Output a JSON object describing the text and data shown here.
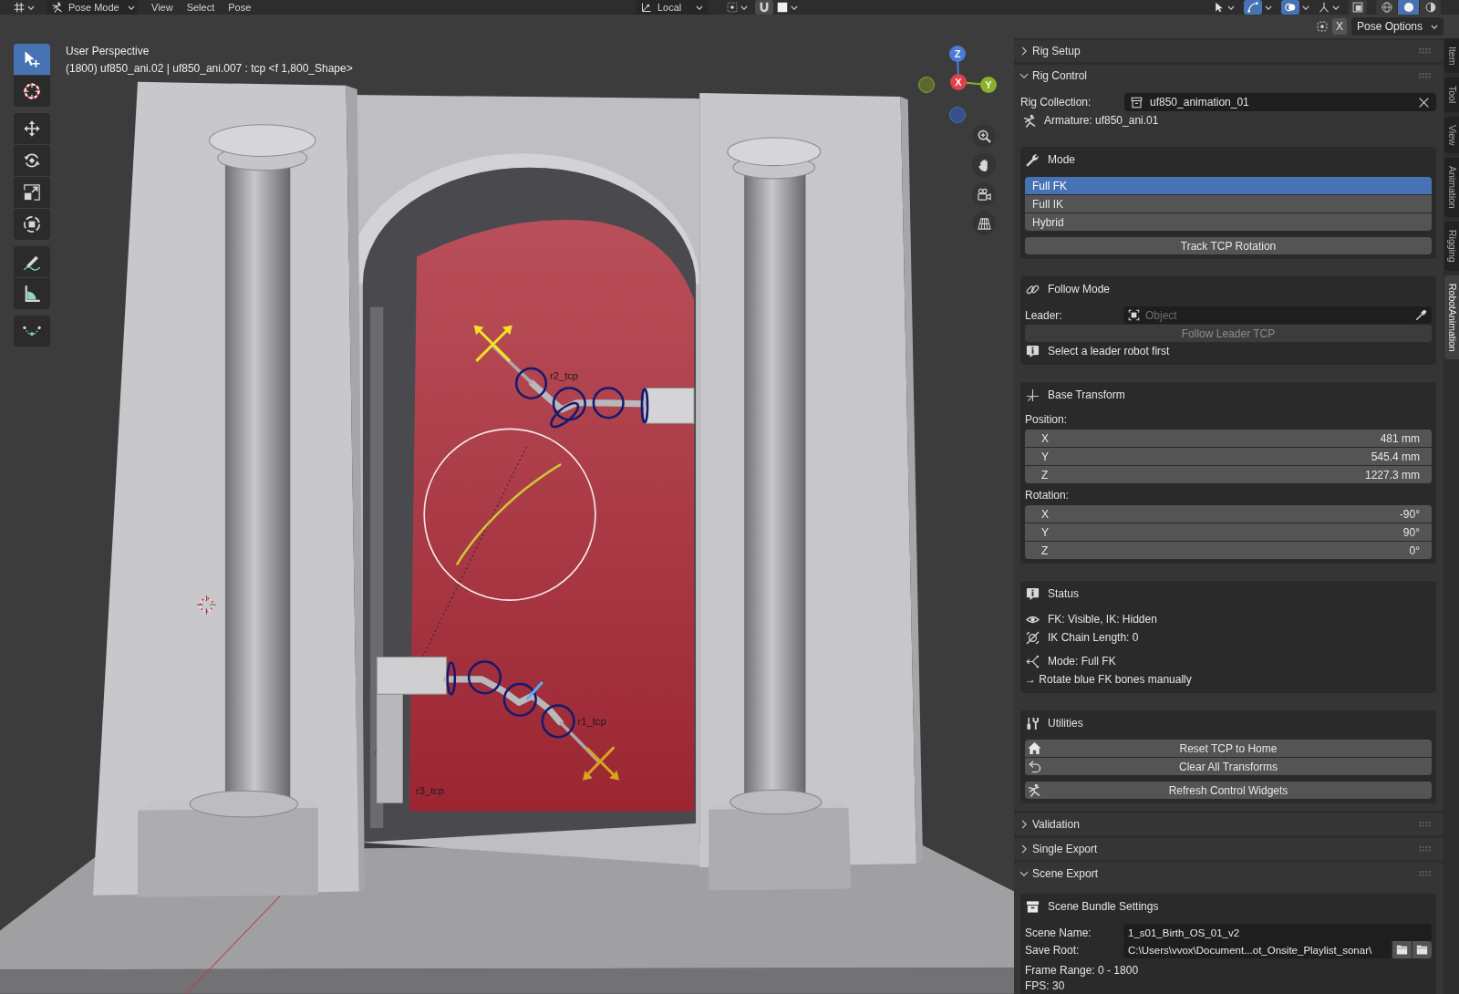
{
  "header": {
    "menus": [
      {
        "kind": "mode",
        "label": "Pose Mode"
      },
      {
        "kind": "menu",
        "label": "View"
      },
      {
        "kind": "menu",
        "label": "Select"
      },
      {
        "kind": "menu",
        "label": "Pose"
      }
    ],
    "orientation": "Local",
    "toggles": [
      {
        "kind": "gizmo",
        "on": true
      },
      {
        "kind": "overlay",
        "on": true
      },
      {
        "kind": "xray",
        "on": false
      }
    ],
    "shading": [
      {
        "kind": "wireframe",
        "selected": false
      },
      {
        "kind": "solid",
        "selected": true
      },
      {
        "kind": "material",
        "selected": false
      }
    ]
  },
  "viewport": {
    "title": "User Perspective",
    "info": "(1800) uf850_ani.02 | uf850_ani.007 : tcp <f 1,800_Shape>",
    "tool_groups": [
      [
        {
          "kind": "select",
          "selected": true
        },
        {
          "kind": "cursor",
          "selected": false
        }
      ],
      [
        {
          "kind": "move",
          "selected": false
        },
        {
          "kind": "rotate",
          "selected": false
        },
        {
          "kind": "scale",
          "selected": false
        },
        {
          "kind": "transform",
          "selected": false
        }
      ],
      [
        {
          "kind": "annotate",
          "selected": false
        },
        {
          "kind": "measure",
          "selected": false
        }
      ],
      [
        {
          "kind": "curve",
          "selected": false
        }
      ]
    ],
    "gizmo_axes": [
      {
        "label": "Z",
        "color": "#4b7bd8"
      },
      {
        "label": "X",
        "color": "#e0404e"
      },
      {
        "label": "Y",
        "color": "#8ab12c"
      }
    ],
    "nav_buttons": [
      {
        "kind": "zoom"
      },
      {
        "kind": "pan"
      },
      {
        "kind": "camera"
      },
      {
        "kind": "grid"
      }
    ],
    "bone_labels": [
      "r2_tcp",
      "r1_tcp",
      "r3_tcp"
    ]
  },
  "tool_header": {
    "toggle": "X",
    "options": "Pose Options"
  },
  "sidebar": {
    "tabs": [
      {
        "label": "Item",
        "selected": false
      },
      {
        "label": "Tool",
        "selected": false
      },
      {
        "label": "View",
        "selected": false
      },
      {
        "label": "Animation",
        "selected": false
      },
      {
        "label": "Rigging",
        "selected": false
      },
      {
        "label": "RobotAnimation",
        "selected": true
      }
    ],
    "panels": [
      {
        "title": "Rig Setup",
        "expanded": false
      },
      {
        "title": "Rig Control",
        "expanded": true,
        "collection": {
          "label": "Rig Collection:",
          "value": "uf850_animation_01"
        },
        "armature": "Armature: uf850_ani.01",
        "subpanels": [
          {
            "kind": "mode",
            "title": "Mode",
            "options": [
              {
                "label": "Full FK",
                "selected": true
              },
              {
                "label": "Full IK",
                "selected": false
              },
              {
                "label": "Hybrid",
                "selected": false
              }
            ],
            "buttons": [
              {
                "label": "Track TCP Rotation",
                "disabled": false
              }
            ]
          },
          {
            "kind": "follow",
            "title": "Follow Mode",
            "field": {
              "label": "Leader:",
              "placeholder": "Object"
            },
            "buttons": [
              {
                "label": "Follow Leader TCP",
                "disabled": true
              }
            ],
            "note": "Select a leader robot first"
          },
          {
            "kind": "transform",
            "title": "Base Transform",
            "groups": [
              {
                "label": "Position:",
                "rows": [
                  {
                    "axis": "X",
                    "value": "481 mm"
                  },
                  {
                    "axis": "Y",
                    "value": "545.4 mm"
                  },
                  {
                    "axis": "Z",
                    "value": "1227.3 mm"
                  }
                ]
              },
              {
                "label": "Rotation:",
                "rows": [
                  {
                    "axis": "X",
                    "value": "-90°"
                  },
                  {
                    "axis": "Y",
                    "value": "90°"
                  },
                  {
                    "axis": "Z",
                    "value": "0°"
                  }
                ]
              }
            ]
          },
          {
            "kind": "status",
            "title": "Status",
            "lines": [
              {
                "kind": "visibility",
                "text": "FK: Visible, IK: Hidden"
              },
              {
                "kind": "chain",
                "text": "IK Chain Length: 0"
              },
              {
                "kind": "mode",
                "text": "Mode: Full FK"
              },
              {
                "kind": "hint",
                "text": "→ Rotate blue FK bones manually"
              }
            ]
          },
          {
            "kind": "utilities",
            "title": "Utilities",
            "button_groups": [
              {
                "buttons": [
                  {
                    "kind": "home",
                    "label": "Reset TCP to Home"
                  },
                  {
                    "kind": "undo",
                    "label": "Clear All Transforms"
                  }
                ]
              },
              {
                "buttons": [
                  {
                    "kind": "armature",
                    "label": "Refresh Control Widgets"
                  }
                ]
              }
            ]
          }
        ]
      },
      {
        "title": "Validation",
        "expanded": false
      },
      {
        "title": "Single Export",
        "expanded": false
      },
      {
        "title": "Scene Export",
        "expanded": true,
        "subpanels": [
          {
            "kind": "bundle",
            "title": "Scene Bundle Settings",
            "fields": [
              {
                "kind": "text",
                "label": "Scene Name:",
                "value": "1_s01_Birth_OS_01_v2"
              },
              {
                "kind": "path",
                "label": "Save Root:",
                "value": "C:\\Users\\vvox\\Document...ot_Onsite_Playlist_sonar\\"
              }
            ],
            "lines": [
              "Frame Range: 0 - 1800",
              "FPS: 30"
            ]
          }
        ]
      }
    ]
  }
}
